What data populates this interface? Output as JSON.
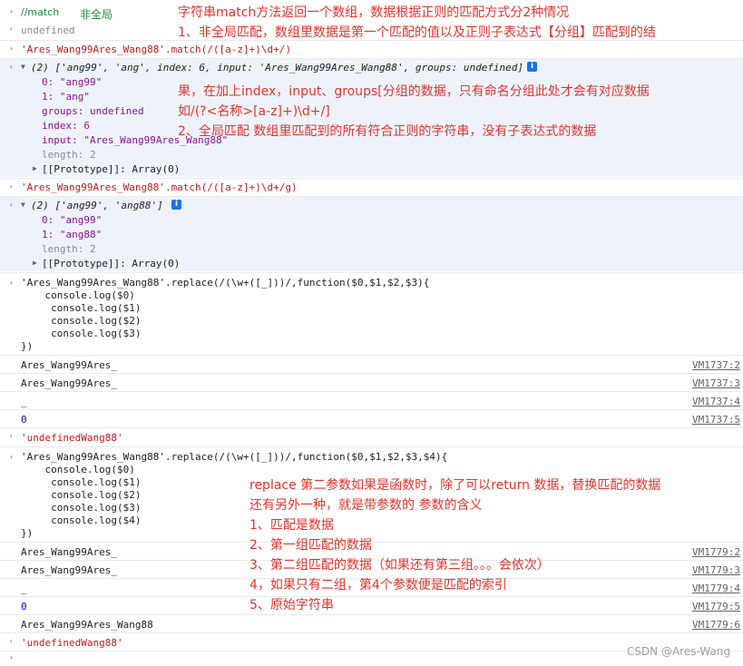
{
  "header": {
    "comment": "//match",
    "note": "非全局"
  },
  "lines": {
    "undefined": "undefined",
    "match_cmd": "'Ares_Wang99Ares_Wang88'.match(/([a-z]+)\\d+/)",
    "arr1_summary": "(2) ['ang99', 'ang', index: 6, input: 'Ares_Wang99Ares_Wang88', groups: undefined]",
    "arr1_0": "0: \"ang99\"",
    "arr1_1": "1: \"ang\"",
    "arr1_groups": "groups: undefined",
    "arr1_index": "index: 6",
    "arr1_input": "input: \"Ares_Wang99Ares_Wang88\"",
    "arr1_length": "length: 2",
    "arr1_proto": "[[Prototype]]: Array(0)",
    "match_g_cmd": "'Ares_Wang99Ares_Wang88'.match(/([a-z]+)\\d+/g)",
    "arr2_summary": "(2) ['ang99', 'ang88']",
    "arr2_0": "0: \"ang99\"",
    "arr2_1": "1: \"ang88\"",
    "arr2_length": "length: 2",
    "arr2_proto": "[[Prototype]]: Array(0)",
    "replace1": "'Ares_Wang99Ares_Wang88'.replace(/(\\w+([_]))/,function($0,$1,$2,$3){\n    console.log($0)\n     console.log($1)\n     console.log($2)\n     console.log($3)\n})",
    "out1_0": "Ares_Wang99Ares_",
    "out1_1": "Ares_Wang99Ares_",
    "out1_2": "_",
    "out1_3": "0",
    "res1": "'undefinedWang88'",
    "replace2": "'Ares_Wang99Ares_Wang88'.replace(/(\\w+([_]))/,function($0,$1,$2,$3,$4){\n    console.log($0)\n     console.log($1)\n     console.log($2)\n     console.log($3)\n     console.log($4)\n})",
    "out2_0": "Ares_Wang99Ares_",
    "out2_1": "Ares_Wang99Ares_",
    "out2_2": "_",
    "out2_3": "0",
    "out2_4": "Ares_Wang99Ares_Wang88",
    "res2": "'undefinedWang88'"
  },
  "links": {
    "a": "VM1737:2",
    "b": "VM1737:3",
    "c": "VM1737:4",
    "d": "VM1737:5",
    "e": "VM1779:2",
    "f": "VM1779:3",
    "g": "VM1779:4",
    "h": "VM1779:5",
    "i": "VM1779:6"
  },
  "annotations": {
    "top": "字符串match方法返回一个数组，数据根据正则的匹配方式分2种情况\n1、非全局匹配，数组里数据是第一个匹配的值以及正则子表达式【分组】匹配到的结",
    "mid": "果，在加上index，input、groups[分组的数据，只有命名分组此处才会有对应数据\n如/(?<名称>[a-z]+)\\d+/]\n2、全局匹配 数组里匹配到的所有符合正则的字符串，没有子表达式的数据",
    "replace": "replace 第二参数如果是函数时，除了可以return 数据，替换匹配的数据\n还有另外一种，就是带参数的 参数的含义\n1、匹配是数据\n2、第一组匹配的数据\n3、第二组匹配的数据（如果还有第三组。。。会依次）\n4，如果只有二组，第4个参数便是匹配的索引\n5、原始字符串"
  },
  "watermark": "CSDN @Ares-Wang"
}
